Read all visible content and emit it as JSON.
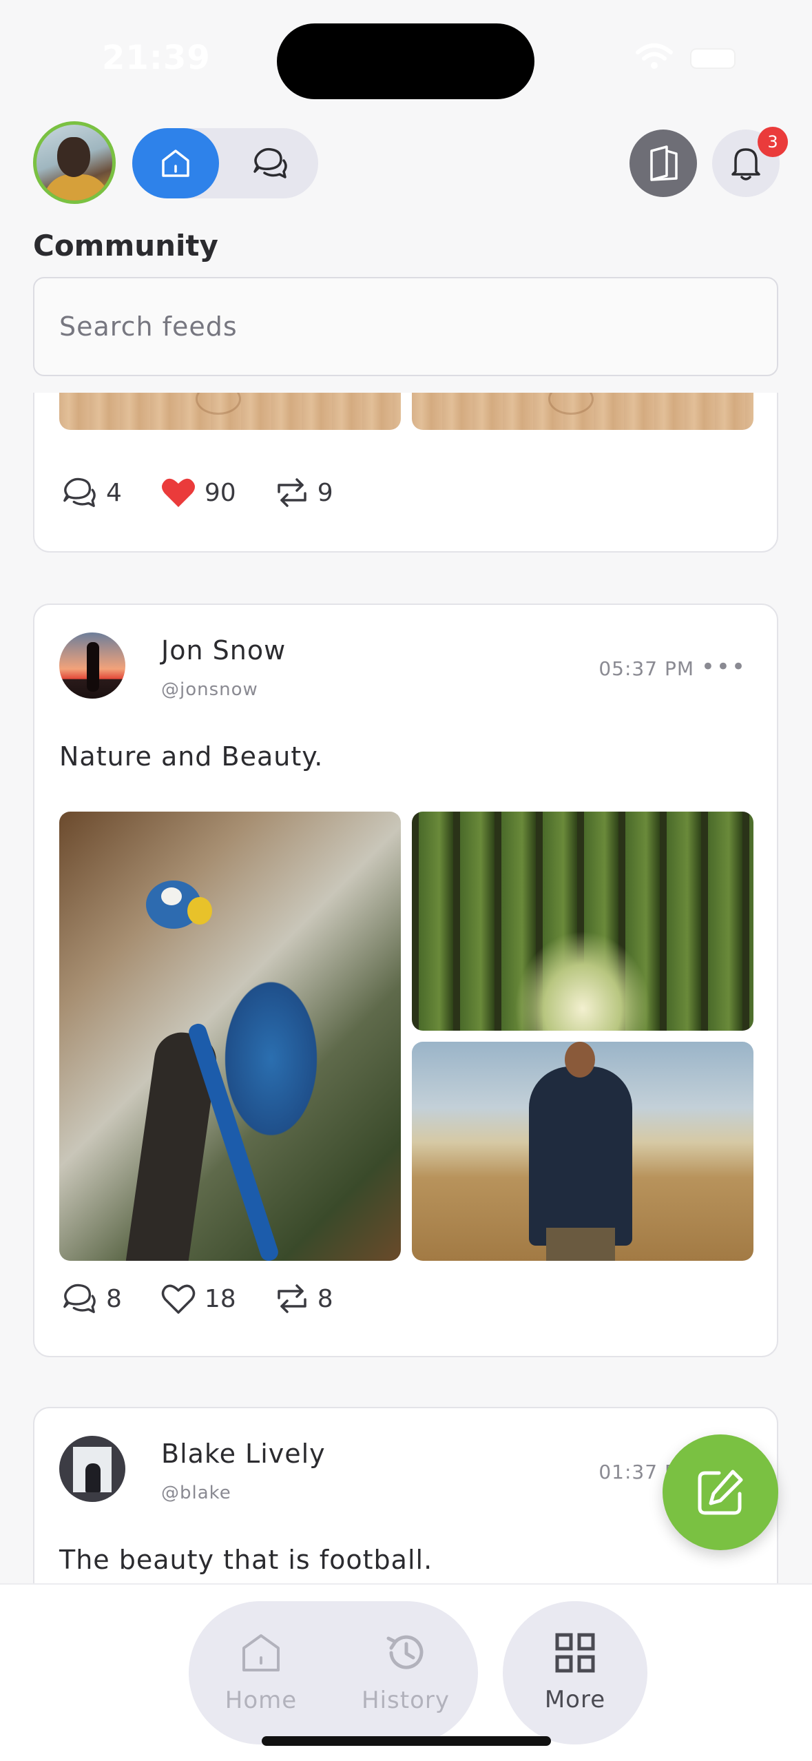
{
  "status_bar": {
    "time": "21:39"
  },
  "header": {
    "title": "Community",
    "search_placeholder": "Search feeds",
    "notification_count": "3"
  },
  "posts": [
    {
      "comments": "4",
      "likes": "90",
      "reposts": "9",
      "liked": true
    },
    {
      "name": "Jon Snow",
      "handle": "@jonsnow",
      "time": "05:37 PM",
      "text": "Nature and Beauty.",
      "comments": "8",
      "likes": "18",
      "reposts": "8",
      "liked": false
    },
    {
      "name": "Blake Lively",
      "handle": "@blake",
      "time": "01:37 PM",
      "text": "The beauty that is football."
    }
  ],
  "more_glyph": "•••",
  "nav": {
    "home": "Home",
    "history": "History",
    "more": "More"
  },
  "colors": {
    "accent_blue": "#2e82ea",
    "accent_green": "#7ac142",
    "like_red": "#ea3b3b"
  }
}
